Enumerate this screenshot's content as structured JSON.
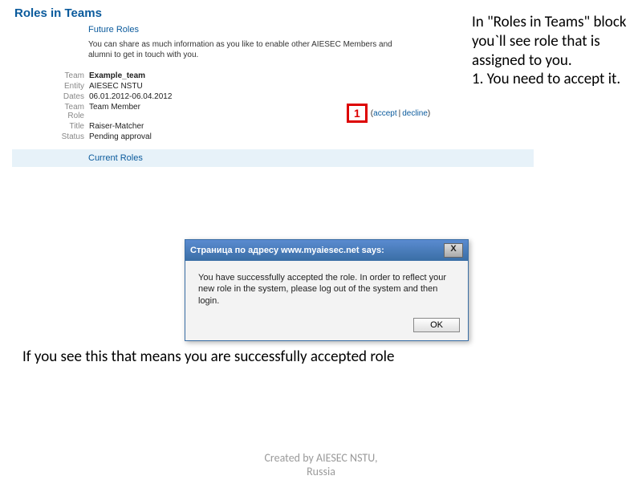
{
  "roles_block": {
    "title": "Roles in Teams",
    "future_section": "Future Roles",
    "intro": "You can share as much information as you like to enable other AIESEC Members and alumni to get in touch with you.",
    "rows": {
      "team_label": "Team",
      "team_value": "Example_team",
      "entity_label": "Entity",
      "entity_value": "AIESEC NSTU",
      "dates_label": "Dates",
      "dates_value": "06.01.2012-06.04.2012",
      "role_label": "Team Role",
      "role_value": "Team Member",
      "title_label": "Title",
      "title_value": "Raiser-Matcher",
      "status_label": "Status",
      "status_value": "Pending approval"
    },
    "marker": "1",
    "accept": "accept",
    "decline": "decline",
    "current_section": "Current Roles"
  },
  "side_note": "In \"Roles in Teams\" block you`ll see role that is assigned to you.\n1. You need to accept it.",
  "dialog": {
    "title": "Страница по адресу www.myaiesec.net says:",
    "message": "You have successfully accepted the role. In order to reflect your new role in the system, please log out of the system and then login.",
    "ok": "OK",
    "close": "X"
  },
  "success_caption": "If you see this that means you are successfully accepted role",
  "footer": "Created by AIESEC NSTU,\nRussia"
}
